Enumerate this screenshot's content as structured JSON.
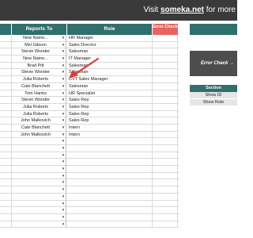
{
  "banner": {
    "prefix": "Visit ",
    "link": "someka.net",
    "suffix": " for more"
  },
  "table": {
    "col_reports_to": "Reports To",
    "col_role": "Role",
    "col_error": "Error Check",
    "rows": [
      {
        "reports_to": "New Name...",
        "role": "HR Manager"
      },
      {
        "reports_to": "Mel Gibson",
        "role": "Sales Director"
      },
      {
        "reports_to": "Stevie Wonder",
        "role": "Salesman"
      },
      {
        "reports_to": "New Name...",
        "role": "IT Manager"
      },
      {
        "reports_to": "Brad Pitt",
        "role": "Salesman"
      },
      {
        "reports_to": "Stevie Wonder",
        "role": "Salesman"
      },
      {
        "reports_to": "Julia Roberts",
        "role": "CVT Sales Manager"
      },
      {
        "reports_to": "Cate Blanchett",
        "role": "Salesman"
      },
      {
        "reports_to": "Tom Hanks",
        "role": "HR Specialist"
      },
      {
        "reports_to": "Stevie Wonder",
        "role": "Sales Rep"
      },
      {
        "reports_to": "Julia Roberts",
        "role": "Sales Rep"
      },
      {
        "reports_to": "Julia Roberts",
        "role": "Sales Rep"
      },
      {
        "reports_to": "John Malkovich",
        "role": "Sales Rep"
      },
      {
        "reports_to": "Cate Blanchett",
        "role": "Intern"
      },
      {
        "reports_to": "John Malkovich",
        "role": "Intern"
      },
      {
        "reports_to": "",
        "role": ""
      },
      {
        "reports_to": "",
        "role": ""
      },
      {
        "reports_to": "",
        "role": ""
      },
      {
        "reports_to": "",
        "role": ""
      },
      {
        "reports_to": "",
        "role": ""
      },
      {
        "reports_to": "",
        "role": ""
      },
      {
        "reports_to": "",
        "role": ""
      },
      {
        "reports_to": "",
        "role": ""
      },
      {
        "reports_to": "",
        "role": ""
      },
      {
        "reports_to": "",
        "role": ""
      },
      {
        "reports_to": "",
        "role": ""
      },
      {
        "reports_to": "",
        "role": ""
      },
      {
        "reports_to": "",
        "role": ""
      }
    ]
  },
  "side_panel": {
    "error_button": "Error Check",
    "error_button_arrow": "→",
    "section_header": "Section",
    "show_id": "Show ID",
    "show_role": "Show Role"
  },
  "dropdown_glyph": "▼",
  "colors": {
    "header": "#2f6f6c",
    "error": "#e8645f",
    "arrow": "#e03a3a",
    "button": "#4d4d4d"
  }
}
